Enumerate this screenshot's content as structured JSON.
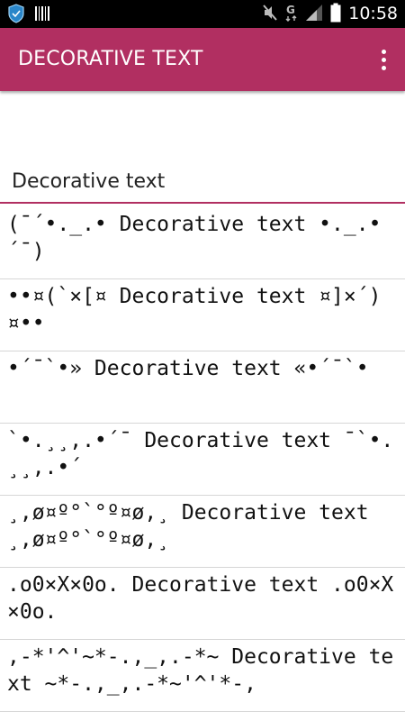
{
  "status_bar": {
    "time": "10:58",
    "icons": [
      "vpn-shield-icon",
      "barcode-icon",
      "mute-icon",
      "g-network-icon",
      "signal-icon",
      "battery-icon"
    ]
  },
  "app_bar": {
    "title": "DECORATIVE TEXT",
    "menu_icon": "overflow-menu-icon"
  },
  "input": {
    "value": "Decorative text"
  },
  "results": [
    {
      "text": "(¯´•._.• Decorative text •._.•´¯)"
    },
    {
      "text": "••¤(`×[¤ Decorative text ¤]×´)¤••"
    },
    {
      "text": "•´¯`•» Decorative text «•´¯`•"
    },
    {
      "text": "`•.¸¸,.•´¯ Decorative text ¯`•.¸¸,.•´"
    },
    {
      "text": "¸,ø¤º°`°º¤ø,¸ Decorative text ¸,ø¤º°`°º¤ø,¸"
    },
    {
      "text": ".o0×X×0o. Decorative text .o0×X×0o."
    },
    {
      "text": ",-*'^'~*-.,_,.-*~ Decorative text ~*-.,_,.-*~'^'*-,"
    }
  ],
  "colors": {
    "accent": "#b12f61",
    "status_bar": "#000000"
  }
}
